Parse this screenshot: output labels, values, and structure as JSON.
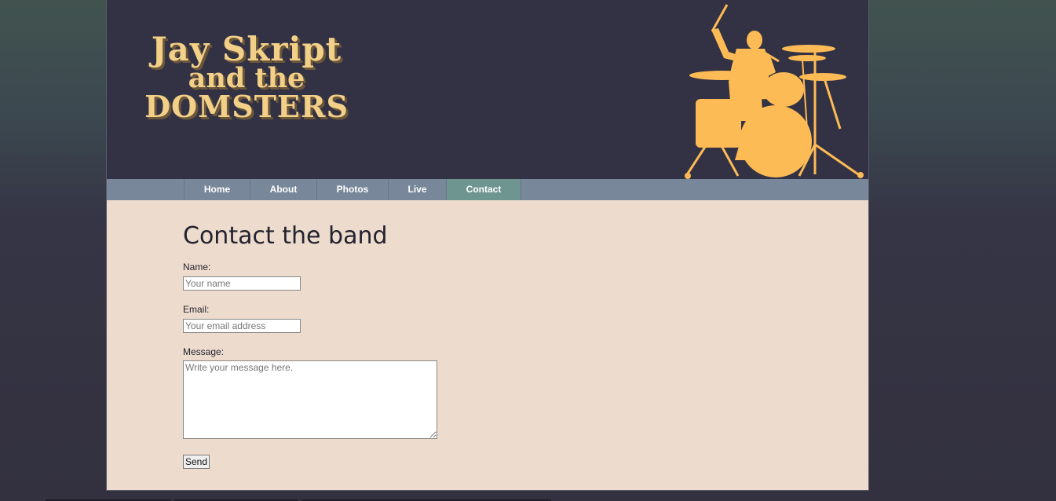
{
  "brand": {
    "line1": "Jay Skript",
    "line2": "and the",
    "line3": "DOMSTERS",
    "color": "#f3d088",
    "drummer_color": "#fdbb55"
  },
  "nav": {
    "items": [
      {
        "label": "Home",
        "active": false
      },
      {
        "label": "About",
        "active": false
      },
      {
        "label": "Photos",
        "active": false
      },
      {
        "label": "Live",
        "active": false
      },
      {
        "label": "Contact",
        "active": true
      }
    ]
  },
  "contact": {
    "title": "Contact the band",
    "name_label": "Name:",
    "name_placeholder": "Your name",
    "email_label": "Email:",
    "email_placeholder": "Your email address",
    "message_label": "Message:",
    "message_placeholder": "Write your message here.",
    "send_label": "Send"
  }
}
